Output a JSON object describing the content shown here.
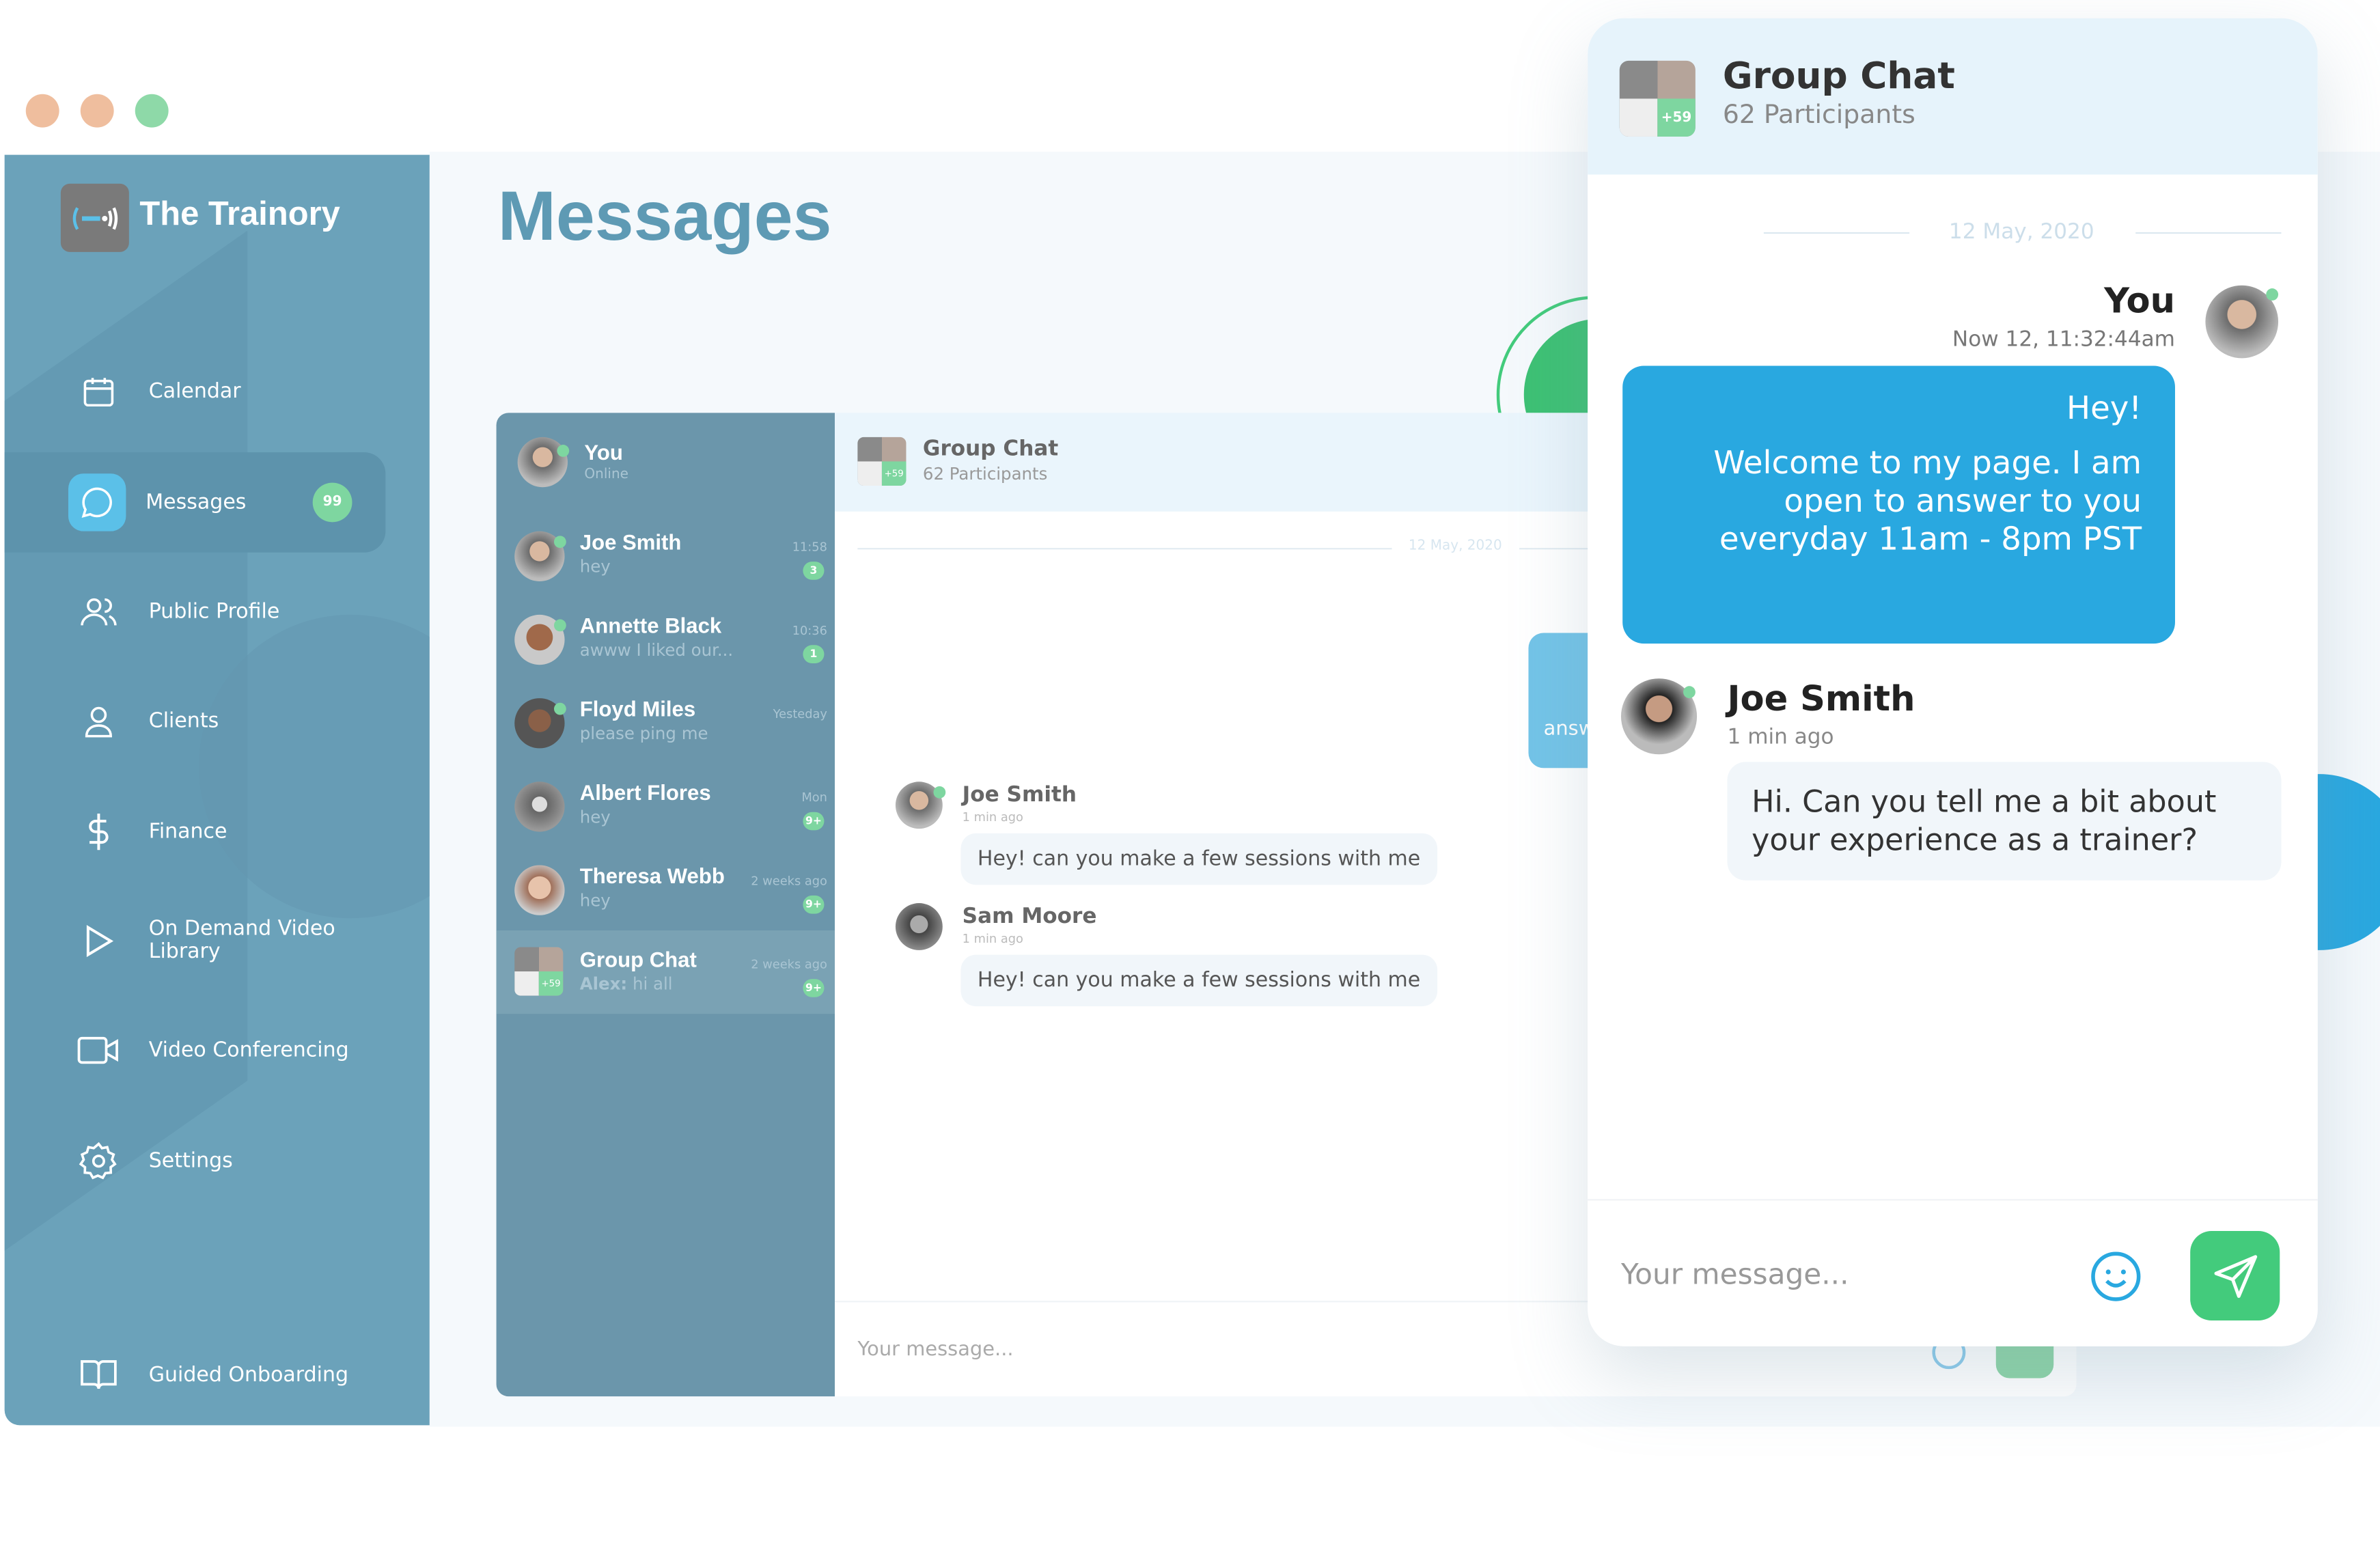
{
  "window": {
    "controls": [
      "close",
      "minimize",
      "maximize"
    ],
    "colors": {
      "close": "#EFBE9E",
      "minimize": "#EFBE9E",
      "maximize": "#8ED9A8"
    }
  },
  "sidebar": {
    "brand": "The Trainory",
    "items": [
      {
        "label": "Calendar",
        "icon": "calendar-icon"
      },
      {
        "label": "Messages",
        "icon": "chat-bubble-icon",
        "badge": "99",
        "active": true
      },
      {
        "label": "Public Profile",
        "icon": "users-icon"
      },
      {
        "label": "Clients",
        "icon": "user-icon"
      },
      {
        "label": "Finance",
        "icon": "dollar-icon"
      },
      {
        "label": "On Demand Video Library",
        "icon": "play-icon"
      },
      {
        "label": "Video Conferencing",
        "icon": "video-camera-icon"
      },
      {
        "label": "Settings",
        "icon": "gear-icon"
      },
      {
        "label": "Guided Onboarding",
        "icon": "book-icon"
      }
    ]
  },
  "page": {
    "title": "Messages"
  },
  "chat_list": {
    "me": {
      "name": "You",
      "status": "Online"
    },
    "items": [
      {
        "name": "Joe Smith",
        "preview": "hey",
        "time": "11:58",
        "unread": "3",
        "online": true
      },
      {
        "name": "Annette Black",
        "preview": "awww I liked our...",
        "time": "10:36",
        "unread": "1",
        "online": true
      },
      {
        "name": "Floyd Miles",
        "preview": "please ping me",
        "time": "Yesteday",
        "unread": "",
        "online": true
      },
      {
        "name": "Albert Flores",
        "preview": "hey",
        "time": "Mon",
        "unread": "9+",
        "online": false
      },
      {
        "name": "Theresa Webb",
        "preview": "hey",
        "time": "2 weeks ago",
        "unread": "9+",
        "online": false
      },
      {
        "name": "Group Chat",
        "preview_sender": "Alex:",
        "preview": "hi all",
        "time": "2 weeks ago",
        "unread": "9+",
        "online": false,
        "selected": true,
        "extra": "+59"
      }
    ]
  },
  "conversation": {
    "title": "Group Chat",
    "participants": "62 Participants",
    "extra": "+59",
    "date": "12 May, 2020",
    "partial_bubble": "answ",
    "messages": [
      {
        "sender": "Joe Smith",
        "time": "1 min ago",
        "text": "Hey! can you make a few sessions with me"
      },
      {
        "sender": "Sam Moore",
        "time": "1 min ago",
        "text": "Hey! can you make a few sessions with me"
      }
    ],
    "input_placeholder": "Your message..."
  },
  "popup": {
    "title": "Group Chat",
    "participants": "62 Participants",
    "extra": "+59",
    "date": "12 May, 2020",
    "my_message": {
      "sender": "You",
      "time": "Now 12, 11:32:44am",
      "lines": [
        "Hey!",
        "Welcome to my page. I am",
        "open to answer to you",
        "everyday 11am - 8pm PST"
      ]
    },
    "reply": {
      "sender": "Joe Smith",
      "time": "1 min ago",
      "text": "Hi. Can you tell me a bit about your experience as a trainer?"
    },
    "input_placeholder": "Your message..."
  },
  "colors": {
    "sidebar": "#6BA2BA",
    "accent_blue": "#29A8E0",
    "accent_green": "#43CB7C",
    "badge_green": "#7ED6A0"
  }
}
